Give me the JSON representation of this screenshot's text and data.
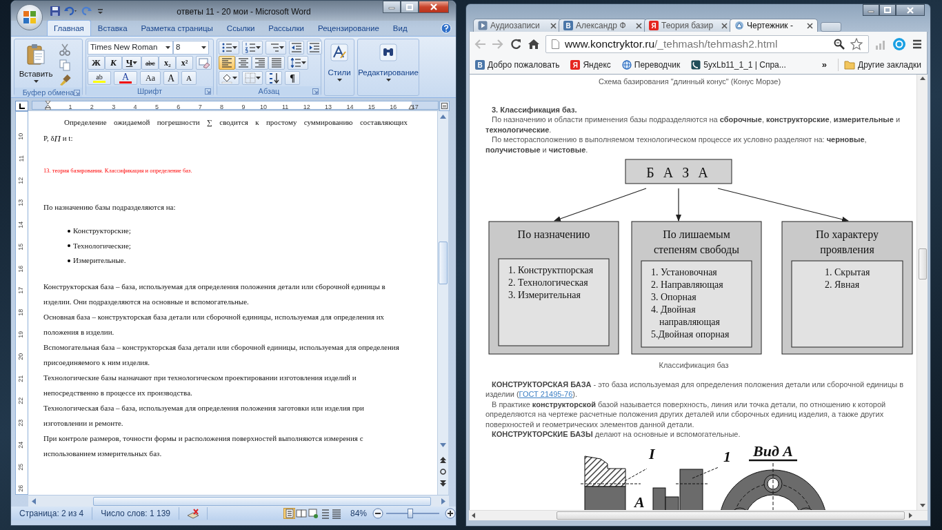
{
  "word": {
    "title": "ответы 11 - 20 мои - Microsoft Word",
    "tabs": [
      {
        "label": "Главная",
        "selected": true
      },
      {
        "label": "Вставка",
        "selected": false
      },
      {
        "label": "Разметка страницы",
        "selected": false
      },
      {
        "label": "Ссылки",
        "selected": false
      },
      {
        "label": "Рассылки",
        "selected": false
      },
      {
        "label": "Рецензирование",
        "selected": false
      },
      {
        "label": "Вид",
        "selected": false
      }
    ],
    "clipboard": {
      "paste_label": "Вставить",
      "group_label": "Буфер обмена"
    },
    "font": {
      "font_name": "Times New Roman",
      "font_size": "8",
      "style_buttons": [
        {
          "kind": "bold",
          "label": "Ж"
        },
        {
          "kind": "italic",
          "label": "К"
        },
        {
          "kind": "underline",
          "label": "Ч"
        },
        {
          "kind": "strike",
          "label": "abc"
        },
        {
          "kind": "sub",
          "label": "x₂"
        },
        {
          "kind": "sup",
          "label": "x²"
        }
      ],
      "highlight_label": "ab",
      "color_label": "A",
      "case_label": "Aa",
      "grow_label": "A",
      "shrink_label": "A",
      "group_label": "Шрифт"
    },
    "paragraph": {
      "align_buttons": [
        {
          "selected": true
        },
        {
          "selected": false
        },
        {
          "selected": false
        },
        {
          "selected": false
        }
      ],
      "pilcrow": "¶",
      "group_label": "Абзац"
    },
    "styles_label": "Стили",
    "editing_label": "Редактирование",
    "ruler": {
      "horizontal": [
        "1",
        "2",
        "3",
        "4",
        "5",
        "6",
        "7",
        "8",
        "9",
        "10",
        "11",
        "12",
        "13",
        "14",
        "15",
        "16",
        "17"
      ],
      "vertical": [
        "10",
        "11",
        "12",
        "13",
        "14",
        "15",
        "16",
        "17",
        "18",
        "19",
        "20",
        "21",
        "22",
        "23",
        "24",
        "25",
        "26"
      ]
    },
    "document": [
      {
        "kind": "justified",
        "text": "Определение ожидаемой погрешности ∑ сводится к простому суммированию составляющих"
      },
      {
        "kind": "formula",
        "text": "P, δ$_{П}$ и t:"
      },
      {
        "kind": "heading",
        "text": "13. теория базирования. Классификация и определение баз."
      },
      {
        "kind": "para",
        "text": "По назначению базы подразделяются на:"
      },
      {
        "kind": "bullet",
        "text": "Конструкторские;"
      },
      {
        "kind": "bullet",
        "text": "Технологические;"
      },
      {
        "kind": "bullet",
        "text": "Измерительные."
      },
      {
        "kind": "para",
        "text": "Конструкторская база – база, используемая для определения положения детали или сборочной единицы в изделии. Они подразделяются на основные и вспомогательные."
      },
      {
        "kind": "para",
        "text": "Основная база – конструкторская база детали или сборочной единицы, используемая для определения их положения в изделии."
      },
      {
        "kind": "para",
        "text": "Вспомогательная база – конструкторская база детали или сборочной единицы, используемая для определения присоединяемого к ним изделия."
      },
      {
        "kind": "para",
        "text": "Технологические базы назначают при технологическом проектировании изготовления изделий и непосредственно в процессе их производства."
      },
      {
        "kind": "para",
        "text": "Технологическая база – база, используемая для определения положения заготовки или изделия при изготовлении и ремонте."
      },
      {
        "kind": "para",
        "text": "При контроле размеров, точности формы и расположения поверхностей выполняются измерения с использованием измерительных баз."
      }
    ],
    "status": {
      "page": "Страница: 2 из 4",
      "words": "Число слов: 1 139",
      "views": [
        {
          "selected": true
        },
        {
          "selected": false
        },
        {
          "selected": false
        },
        {
          "selected": false
        },
        {
          "selected": false
        }
      ],
      "zoom": "84%",
      "zoom_slider": {
        "level": 0.45
      }
    }
  },
  "browser": {
    "tabs": [
      {
        "label": "Аудиозаписи",
        "selected": false,
        "kind": "play"
      },
      {
        "label": "Александр Ф",
        "selected": false,
        "kind": "letter",
        "icon_text": "В",
        "color": "#4a76a8"
      },
      {
        "label": "Теория базир",
        "selected": false,
        "kind": "letter",
        "icon_text": "Я",
        "color": "#e52620"
      },
      {
        "label": "Чертежник -",
        "selected": true,
        "kind": "site"
      }
    ],
    "url_host": "www.konctryktor.ru",
    "url_path": "/_tehmash/tehmash2.html",
    "bookmarks": [
      {
        "label": "Добро пожаловать",
        "kind": "letter",
        "icon_text": "В",
        "color": "#4a76a8"
      },
      {
        "label": "Яндекс",
        "kind": "letter",
        "icon_text": "Я",
        "color": "#e52620"
      },
      {
        "label": "Переводчик",
        "kind": "globe"
      },
      {
        "label": "5yxLb11_1_1 | Спра...",
        "kind": "phone"
      }
    ],
    "bookmarks_overflow": "»",
    "other_bookmarks": "Другие закладки",
    "page": {
      "caption_top": "Схема базирования \"длинный конус\" (Конус Морзе)",
      "heading": "3. Классификация баз.",
      "intro": [
        "По назначению и области применения базы подразделяются на **сборочные**, **конструкторские**, **измерительные** и **технологические**.",
        "По месторасположению в выполняемом технологическом процессе их условно разделяют на: **черновые**, **получистовые** и **чистовые**."
      ],
      "diagram": {
        "root": "Б А З А",
        "categories": [
          {
            "title": [
              "По назначению"
            ],
            "items": [
              [
                "1. Конструктпорская"
              ],
              [
                "2. Технологическая"
              ],
              [
                "3. Измерительная"
              ]
            ]
          },
          {
            "title": [
              "По лишаемым",
              "степеням свободы"
            ],
            "items": [
              [
                "1. Установочная"
              ],
              [
                "2. Направляющая"
              ],
              [
                "3. Опорная"
              ],
              [
                "4. Двойная",
                "направляющая"
              ],
              [
                "5.Двойная опорная"
              ]
            ]
          },
          {
            "title": [
              "По характеру",
              "проявления"
            ],
            "items": [
              [
                "1. Скрытая"
              ],
              [
                "2. Явная"
              ]
            ]
          }
        ]
      },
      "diagram_caption": "Классификация баз",
      "definition": {
        "before": "**КОНСТРУКТОРСКАЯ БАЗА** - это база используемая для определения положения детали или сборочной единицы в изделии (",
        "link": "ГОСТ 21495-76",
        "after": ")."
      },
      "body": [
        "В практике **конструкторской** базой называется поверхность, линия или точка детали, по отношению к которой определяются на чертеже расчетные положения других деталей или сборочных единиц изделия, а также других поверхностей и геометрических элементов данной детали.",
        "**КОНСТРУКТОРСКИЕ БАЗЫ** делают на основные и вспомогательные."
      ],
      "drawing_labels": [
        "I",
        "1",
        "Вид А",
        "А"
      ]
    }
  }
}
